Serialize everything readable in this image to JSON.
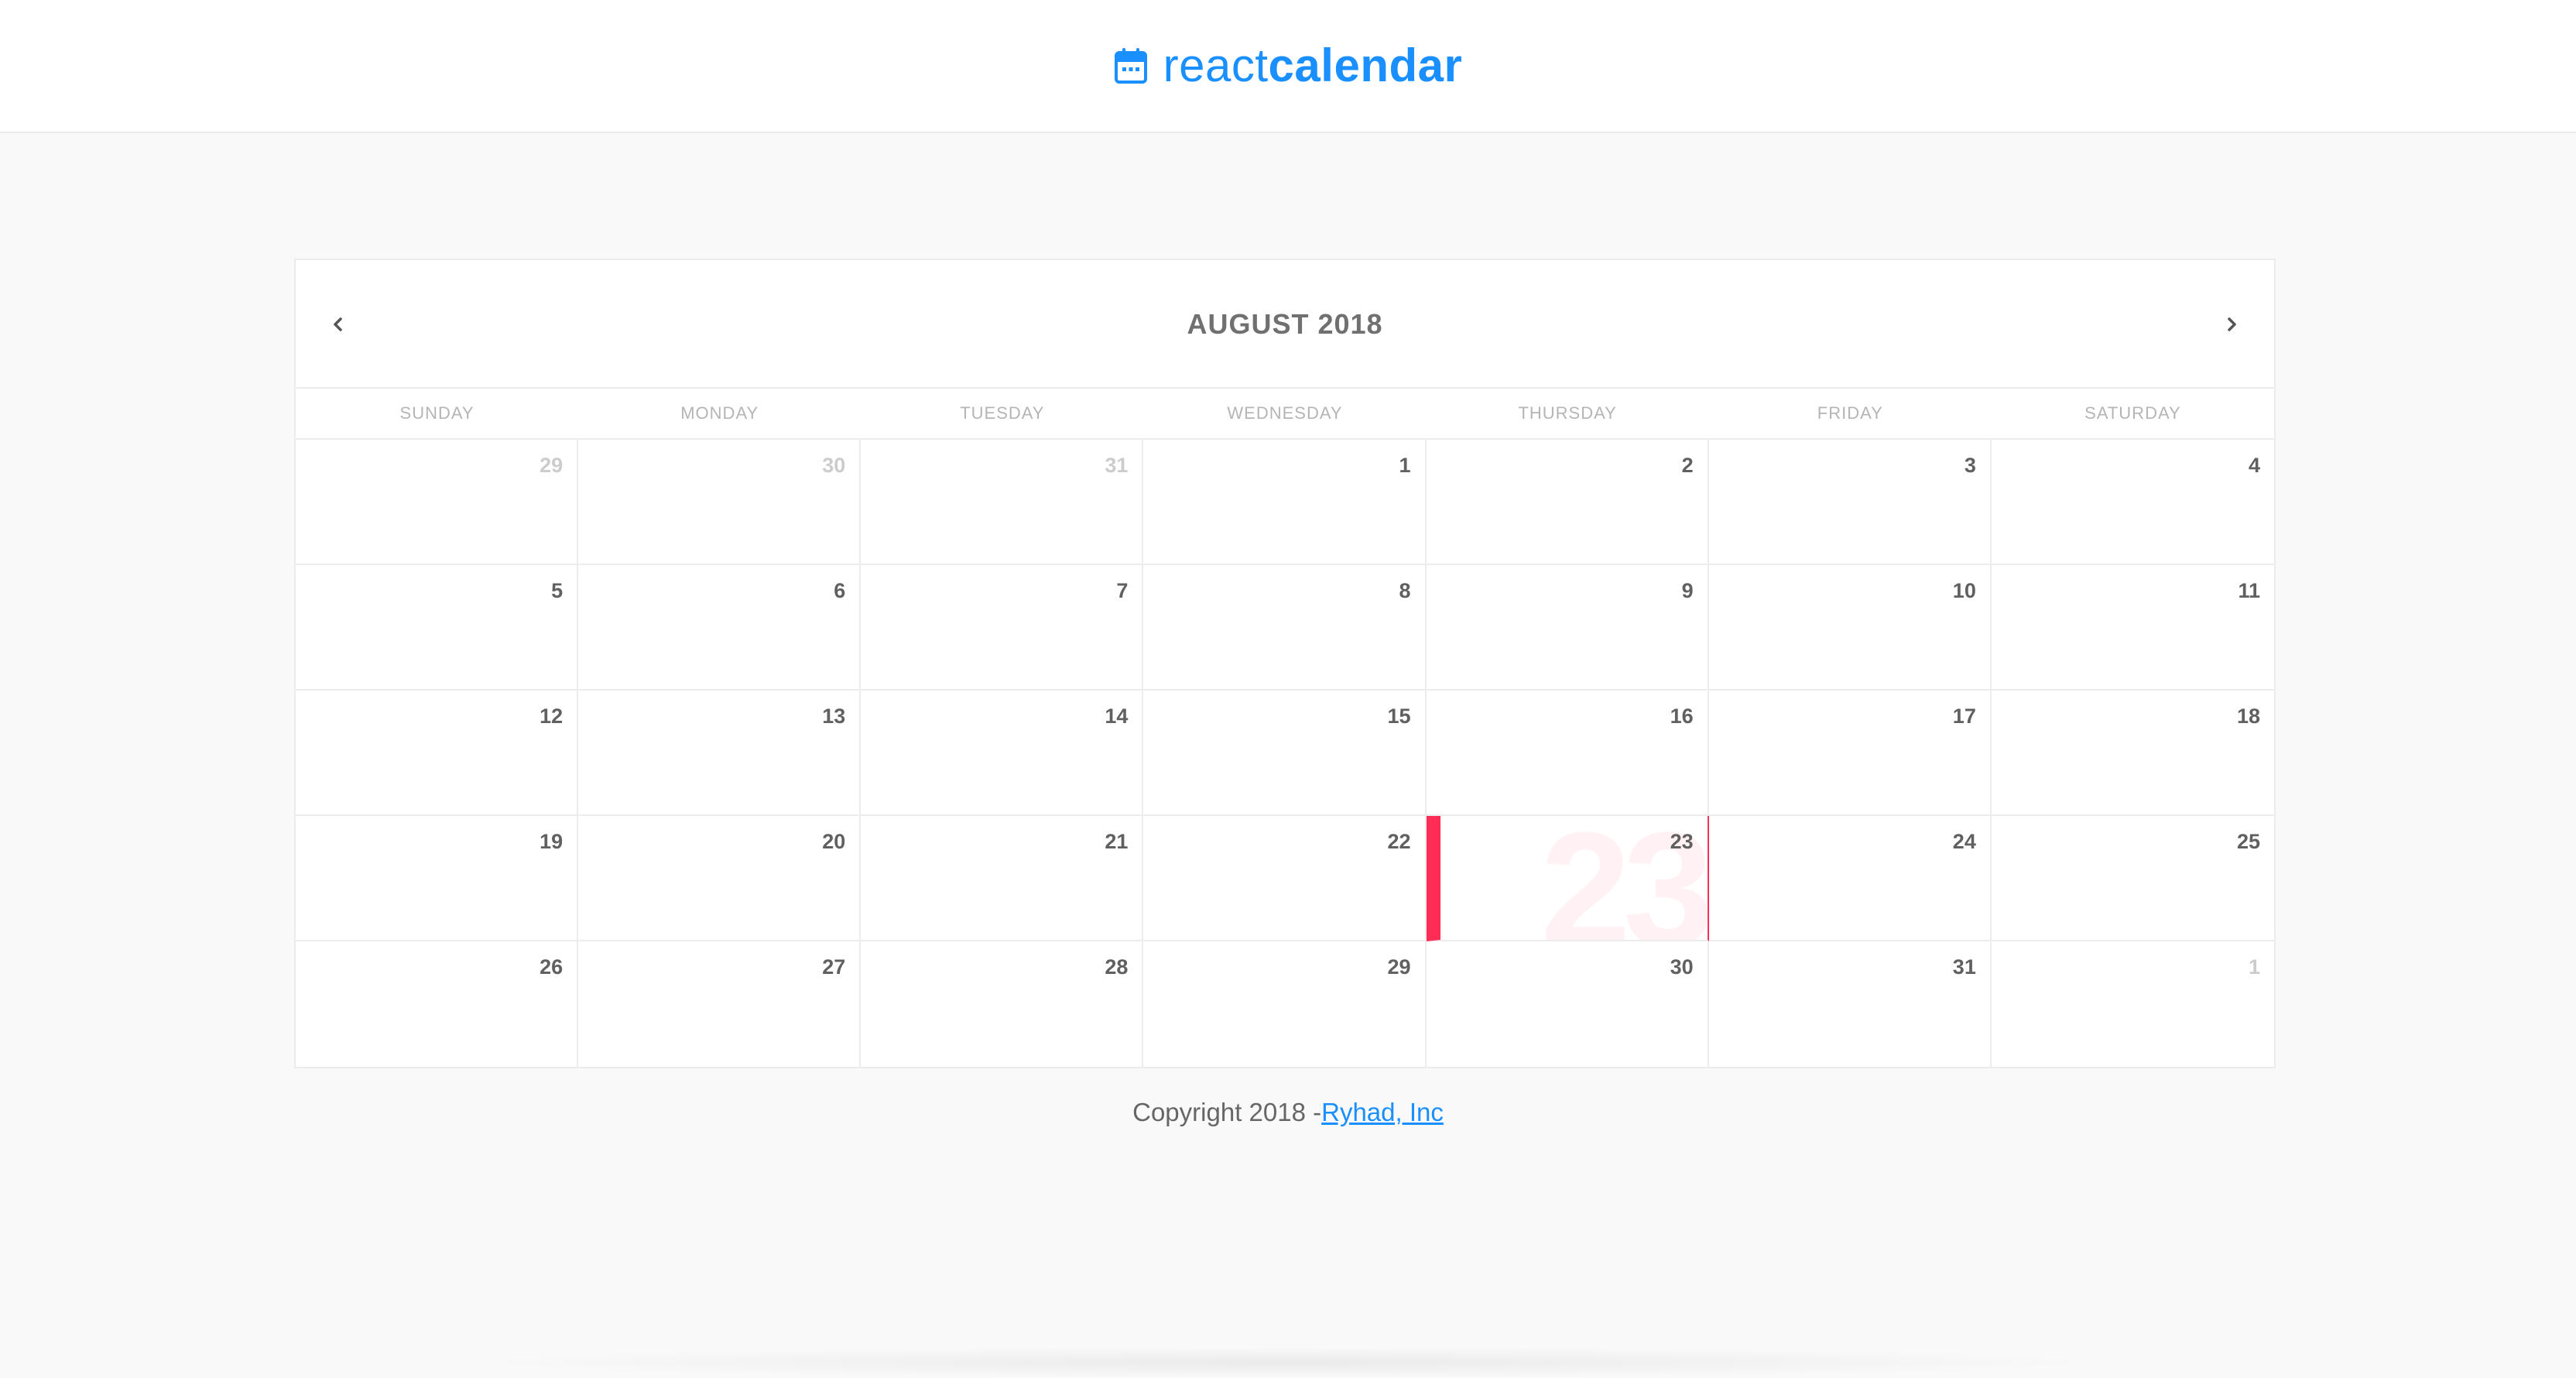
{
  "header": {
    "logo_icon": "calendar-icon",
    "brand_light": "react",
    "brand_bold": "calendar",
    "brand_color": "#1a8fff"
  },
  "calendar": {
    "month_title": "AUGUST 2018",
    "prev_icon": "chevron-left-icon",
    "next_icon": "chevron-right-icon",
    "days_of_week": [
      "SUNDAY",
      "MONDAY",
      "TUESDAY",
      "WEDNESDAY",
      "THURSDAY",
      "FRIDAY",
      "SATURDAY"
    ],
    "selected_day": "23",
    "accent_color": "#ff2d55",
    "weeks": [
      [
        {
          "day": "29",
          "muted": true
        },
        {
          "day": "30",
          "muted": true
        },
        {
          "day": "31",
          "muted": true
        },
        {
          "day": "1"
        },
        {
          "day": "2"
        },
        {
          "day": "3"
        },
        {
          "day": "4"
        }
      ],
      [
        {
          "day": "5"
        },
        {
          "day": "6"
        },
        {
          "day": "7"
        },
        {
          "day": "8"
        },
        {
          "day": "9"
        },
        {
          "day": "10"
        },
        {
          "day": "11"
        }
      ],
      [
        {
          "day": "12"
        },
        {
          "day": "13"
        },
        {
          "day": "14"
        },
        {
          "day": "15"
        },
        {
          "day": "16"
        },
        {
          "day": "17"
        },
        {
          "day": "18"
        }
      ],
      [
        {
          "day": "19"
        },
        {
          "day": "20"
        },
        {
          "day": "21"
        },
        {
          "day": "22"
        },
        {
          "day": "23",
          "selected": true
        },
        {
          "day": "24"
        },
        {
          "day": "25"
        }
      ],
      [
        {
          "day": "26"
        },
        {
          "day": "27"
        },
        {
          "day": "28"
        },
        {
          "day": "29"
        },
        {
          "day": "30"
        },
        {
          "day": "31"
        },
        {
          "day": "1",
          "muted": true
        }
      ]
    ]
  },
  "footer": {
    "copyright_text": "Copyright 2018 -",
    "company_link": "Ryhad, Inc"
  }
}
